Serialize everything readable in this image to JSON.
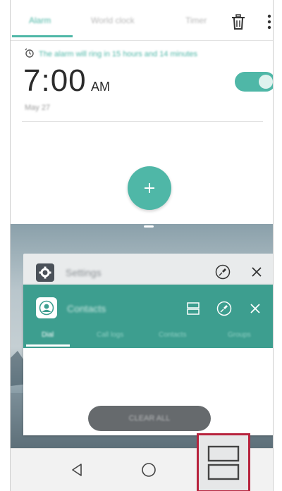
{
  "clock": {
    "tabs": [
      {
        "label": "Alarm",
        "active": true
      },
      {
        "label": "World clock",
        "active": false
      },
      {
        "label": "Timer",
        "active": false
      }
    ],
    "icons": {
      "delete": "trash-icon",
      "more": "more-vertical-icon"
    },
    "alarm": {
      "notice": "The alarm will ring in 15 hours and 14 minutes",
      "time": "7:00",
      "ampm": "AM",
      "date": "May 27",
      "enabled": true
    },
    "add_icon": "plus-icon"
  },
  "recents": {
    "settings_card": {
      "title": "Settings",
      "icon": "gear-icon",
      "pin_icon": "pin-icon",
      "close_icon": "close-icon"
    },
    "contacts_card": {
      "title": "Contacts",
      "icon": "contact-icon",
      "split_icon": "split-screen-icon",
      "pin_icon": "pin-icon",
      "close_icon": "close-icon",
      "tabs": [
        {
          "label": "Dial",
          "active": true
        },
        {
          "label": "Call logs",
          "active": false
        },
        {
          "label": "Contacts",
          "active": false
        },
        {
          "label": "Groups",
          "active": false
        }
      ]
    },
    "clear_all": "CLEAR ALL"
  },
  "navbar": {
    "back": "back-icon",
    "home": "home-icon",
    "recents": "recents-split-icon"
  },
  "colors": {
    "accent": "#4fb7a7",
    "contacts_header": "#3d9e8f",
    "highlight": "#b7233d"
  }
}
